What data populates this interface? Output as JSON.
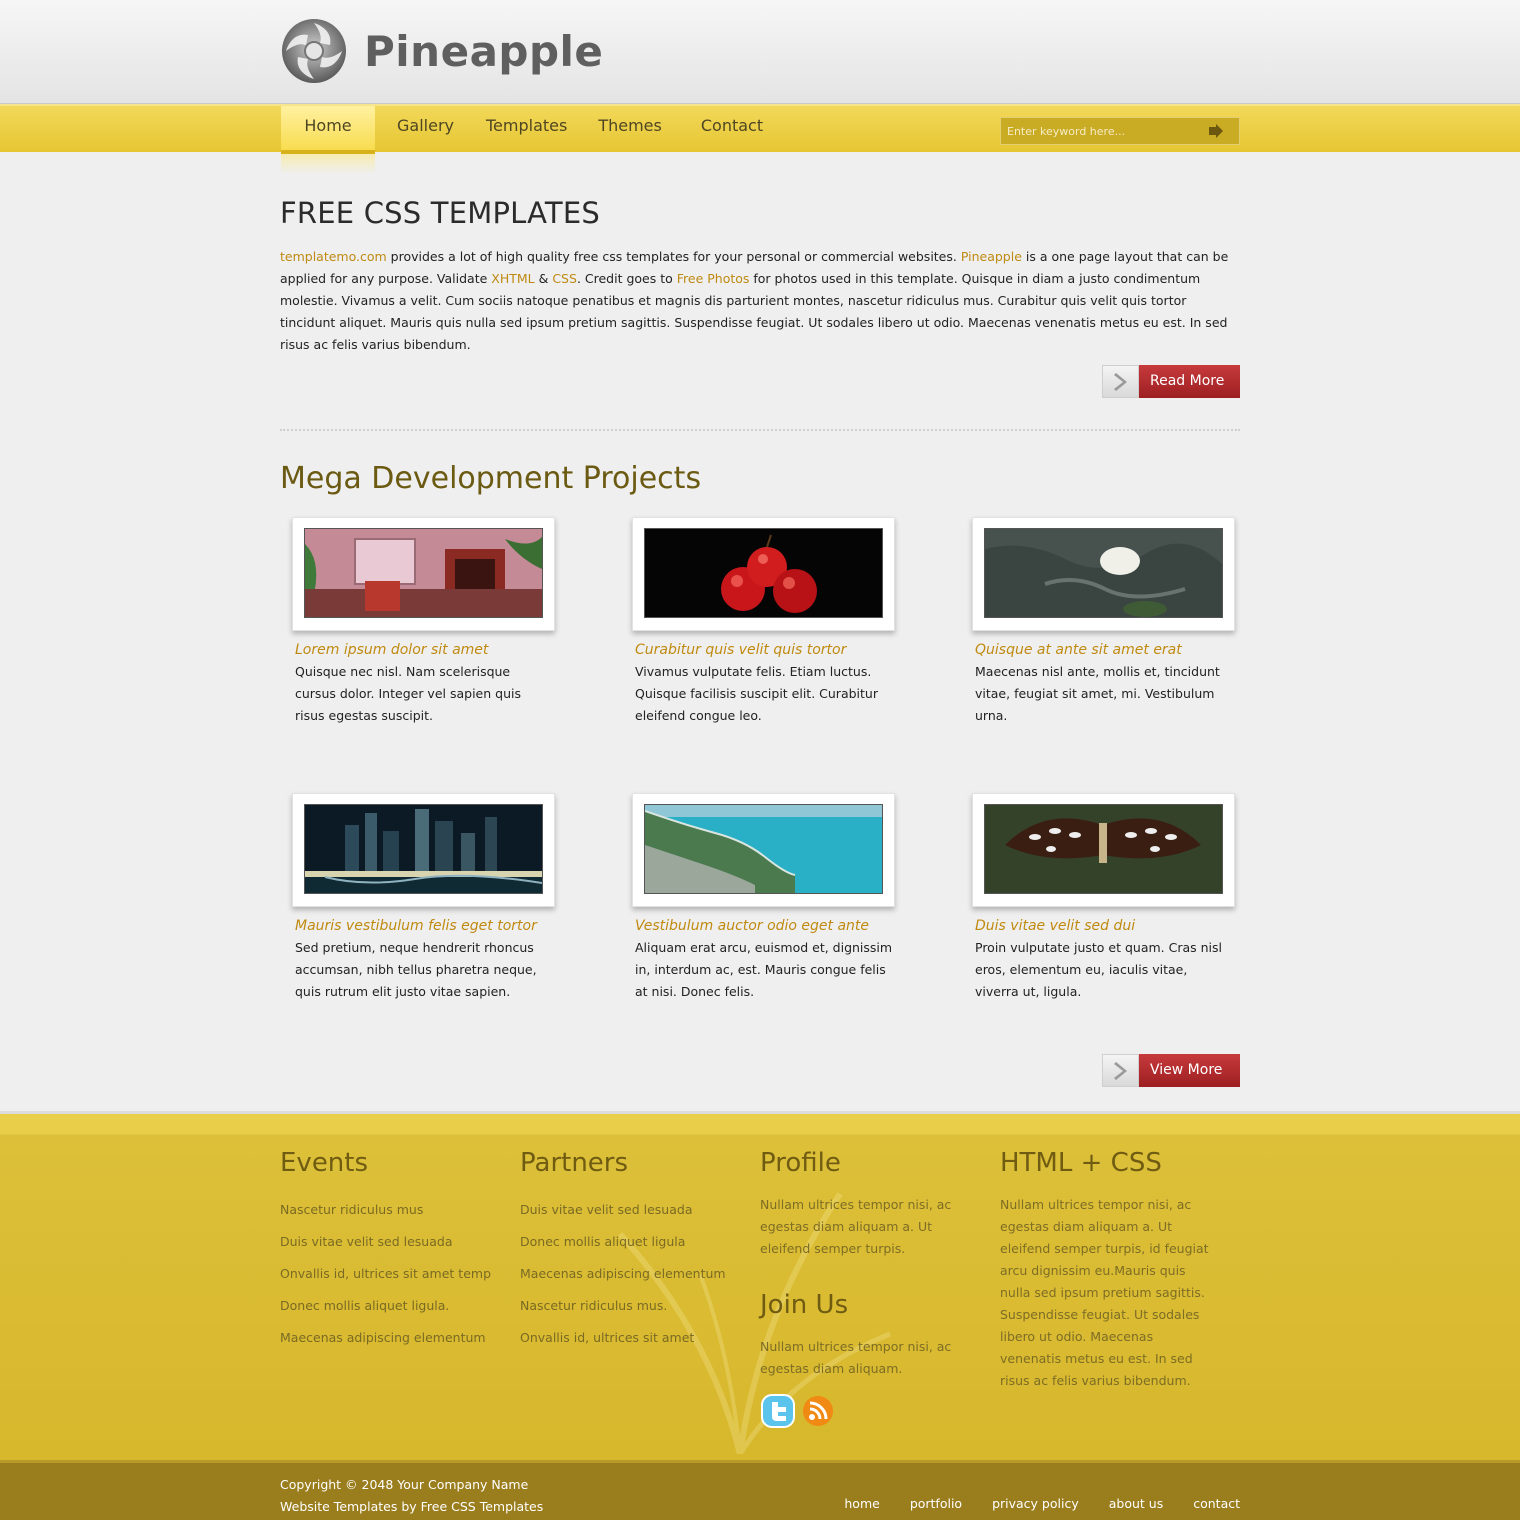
{
  "brand": {
    "name": "Pineapple"
  },
  "nav": {
    "items": [
      "Home",
      "Gallery",
      "Templates",
      "Themes",
      "Contact"
    ],
    "search_placeholder": "Enter keyword here..."
  },
  "intro": {
    "heading": "FREE CSS TEMPLATES",
    "link_templatemo": "templatemo.com",
    "t1": " provides a lot of high quality free css templates for your personal or commercial websites. ",
    "link_pineapple": "Pineapple",
    "t2": " is a one page layout that can be applied for any purpose. Validate ",
    "link_xhtml": "XHTML",
    "t3": " & ",
    "link_css": "CSS",
    "t4": ". Credit goes to ",
    "link_photos": "Free Photos",
    "t5": " for photos used in this template. Quisque in diam a justo condimentum molestie. Vivamus a velit. Cum sociis natoque penatibus et magnis dis parturient montes, nascetur ridiculus mus. Curabitur quis velit quis tortor tincidunt aliquet. Mauris quis nulla sed ipsum pretium sagittis. Suspendisse feugiat. Ut sodales libero ut odio. Maecenas venenatis metus eu est. In sed risus ac felis varius bibendum.",
    "read_more": "Read More"
  },
  "projects": {
    "heading": "Mega Development Projects",
    "items": [
      {
        "title": "Lorem ipsum dolor sit amet",
        "desc": "Quisque nec nisl. Nam scelerisque cursus dolor. Integer vel sapien quis risus egestas suscipit."
      },
      {
        "title": "Curabitur quis velit quis tortor",
        "desc": "Vivamus vulputate felis. Etiam luctus. Quisque facilisis suscipit elit. Curabitur eleifend congue leo."
      },
      {
        "title": "Quisque at ante sit amet erat",
        "desc": "Maecenas nisl ante, mollis et, tincidunt vitae, feugiat sit amet, mi. Vestibulum urna."
      },
      {
        "title": "Mauris vestibulum felis eget tortor",
        "desc": "Sed pretium, neque hendrerit rhoncus accumsan, nibh tellus pharetra neque, quis rutrum elit justo vitae sapien."
      },
      {
        "title": "Vestibulum auctor odio eget ante",
        "desc": "Aliquam erat arcu, euismod et, dignissim in, interdum ac, est. Mauris congue felis at nisi. Donec felis."
      },
      {
        "title": "Duis vitae velit sed dui",
        "desc": "Proin vulputate justo et quam. Cras nisl eros, elementum eu, iaculis vitae, viverra ut, ligula."
      }
    ],
    "view_more": "View More"
  },
  "footer": {
    "events": {
      "heading": "Events",
      "items": [
        "Nascetur ridiculus mus",
        "Duis vitae velit sed lesuada",
        "Onvallis id, ultrices sit amet temp",
        "Donec mollis aliquet ligula.",
        "Maecenas adipiscing elementum"
      ]
    },
    "partners": {
      "heading": "Partners",
      "items": [
        "Duis vitae velit sed lesuada",
        "Donec mollis aliquet ligula",
        "Maecenas adipiscing elementum",
        "Nascetur ridiculus mus.",
        "Onvallis id, ultrices sit amet"
      ]
    },
    "profile": {
      "heading": "Profile",
      "text": "Nullam ultrices tempor nisi, ac egestas diam aliquam a. Ut eleifend semper turpis."
    },
    "join": {
      "heading": "Join Us",
      "text": "Nullam ultrices tempor nisi, ac egestas diam aliquam."
    },
    "htmlcss": {
      "heading": "HTML + CSS",
      "text": "Nullam ultrices tempor nisi, ac egestas diam aliquam a. Ut eleifend semper turpis, id feugiat arcu dignissim eu.Mauris quis nulla sed ipsum pretium sagittis. Suspendisse feugiat. Ut sodales libero ut odio. Maecenas venenatis metus eu est. In sed risus ac felis varius bibendum."
    },
    "social_icons": [
      "twitter-icon",
      "rss-icon"
    ]
  },
  "bottom": {
    "copyright": "Copyright © 2048 Your Company Name",
    "credit": "Website Templates by Free CSS Templates",
    "links": [
      "home",
      "portfolio",
      "privacy policy",
      "about us",
      "contact"
    ]
  },
  "colors": {
    "accent_link": "#bf8a12",
    "button_red": "#b02a2d",
    "menu_yellow": "#e9ca3c",
    "footer_bottom": "#9a7d1c"
  }
}
